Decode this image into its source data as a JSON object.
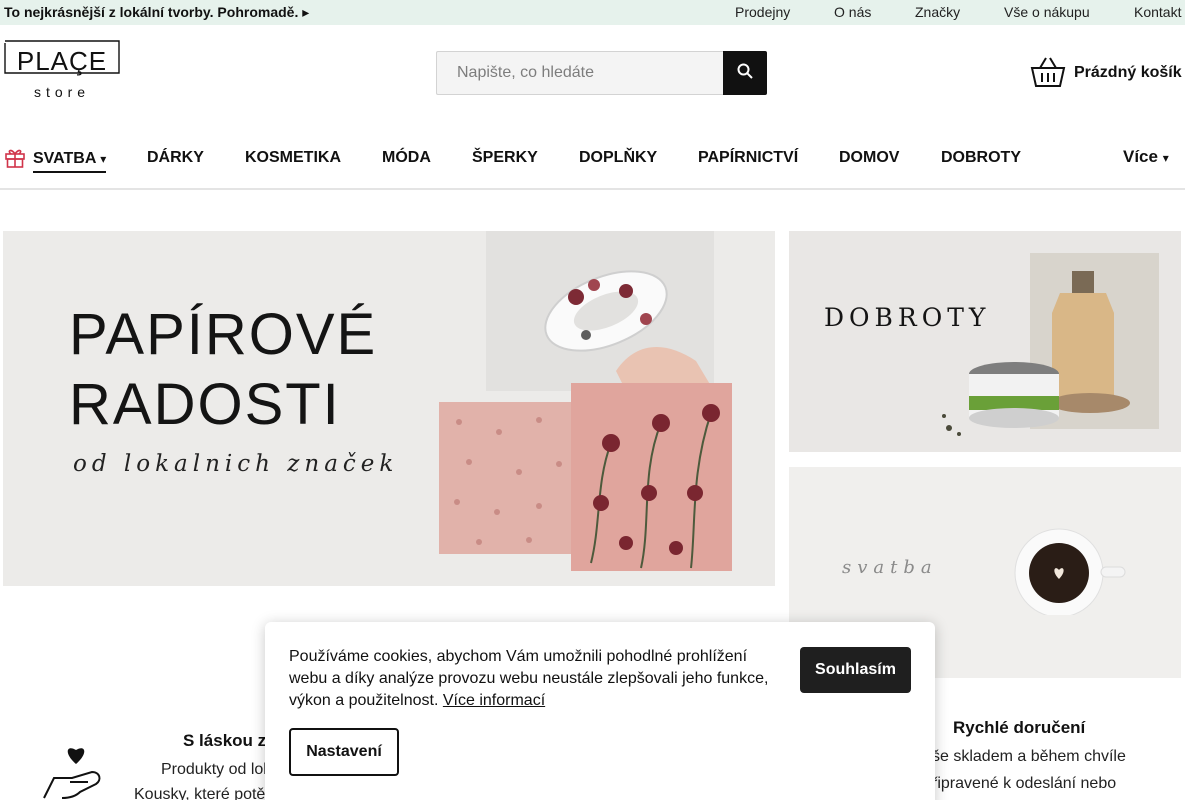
{
  "topbar": {
    "promo": "To nejkrásnější z lokální tvorby. Pohromadě. ",
    "links": [
      "Prodejny",
      "O nás",
      "Značky",
      "Vše o nákupu",
      "Kontakt"
    ]
  },
  "header": {
    "logo_text": "PLAÇE",
    "logo_sub": "store",
    "search_placeholder": "Napište, co hledáte",
    "search_icon": "search-icon",
    "cart_label": "Prázdný košík",
    "cart_icon": "basket-icon"
  },
  "nav": {
    "items": [
      "SVATBA",
      "DÁRKY",
      "KOSMETIKA",
      "MÓDA",
      "ŠPERKY",
      "DOPLŇKY",
      "PAPÍRNICTVÍ",
      "DOMOV",
      "DOBROTY"
    ],
    "more_label": "Více",
    "svatba_icon": "gift-icon",
    "chevron": "▾"
  },
  "banners": {
    "main": {
      "line1": "PAPÍROVÉ",
      "line2": "RADOSTI",
      "sub": "od lokalnich značek"
    },
    "dobroty": {
      "title": "DOBROTY"
    },
    "svatba": {
      "title": "svatba"
    }
  },
  "features": {
    "love": {
      "title": "S láskou z",
      "line1": "Produkty od lok",
      "line2": "Kousky, které potě"
    },
    "delivery": {
      "title": "Rychlé doručení",
      "line1": "še skladem a během chvíle",
      "line2": "řipravené k odeslání nebo"
    }
  },
  "cookie": {
    "message": "Používáme cookies, abychom Vám umožnili pohodlné prohlížení webu a díky analýze provozu webu neustále zlepšovali jeho funkce, výkon a použitelnost. ",
    "more_link": "Více informací",
    "accept_label": "Souhlasím",
    "settings_label": "Nastavení"
  },
  "colors": {
    "topbar_bg": "#e6f2ec",
    "accent_dark": "#1f1f1f",
    "gift_red": "#d0344a"
  }
}
